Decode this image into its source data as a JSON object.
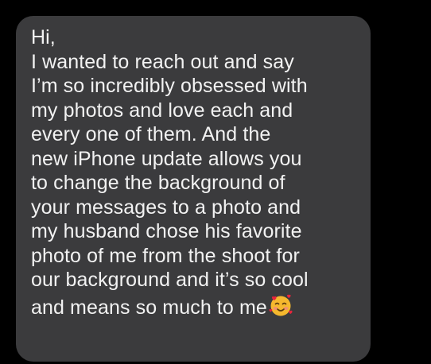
{
  "message": {
    "lines": [
      "Hi,",
      "I wanted to reach out and say",
      "I’m so incredibly obsessed with",
      "my photos and love each and",
      "every one of them. And the",
      "new iPhone update allows you",
      "to change the background of",
      "your messages to a photo and",
      "my husband chose his favorite",
      "photo of me from the shoot for",
      "our background and it’s so cool",
      "and means so much to me"
    ],
    "trailing_emoji": "smiling-face-with-hearts-icon"
  },
  "colors": {
    "background": "#000000",
    "bubble": "#3b3b3d",
    "text": "#f2f2f2",
    "emoji_face": "#f5b82e",
    "emoji_heart": "#e8243c",
    "emoji_blush": "#f08a7a"
  }
}
